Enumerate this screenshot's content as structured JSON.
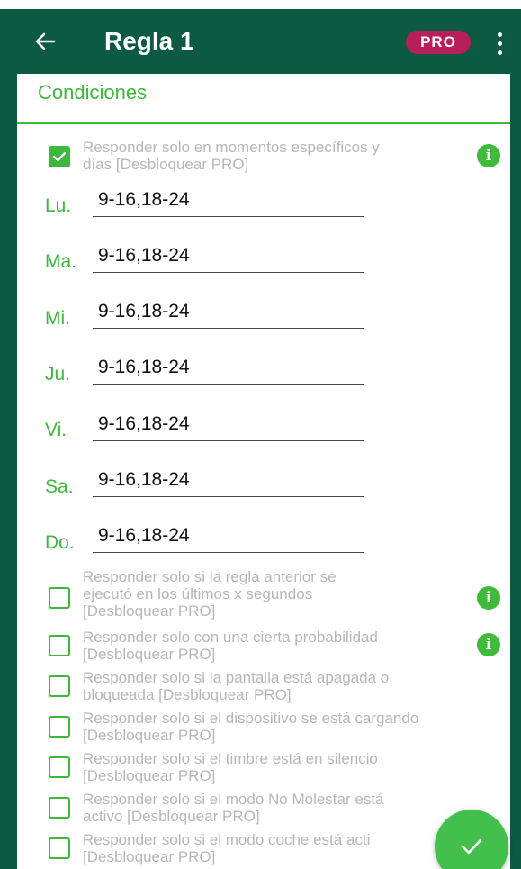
{
  "appbar": {
    "title": "Regla 1",
    "pro_badge": "PRO",
    "back_icon": "arrow-left-icon",
    "menu_icon": "more-vert-icon"
  },
  "section": {
    "title": "Condiciones"
  },
  "time_condition": {
    "checked": true,
    "line1": "Responder solo en momentos específicos y",
    "line2": "días [Desbloquear PRO]"
  },
  "days": [
    {
      "label": "Lu.",
      "value": "9-16,18-24"
    },
    {
      "label": "Ma.",
      "value": "9-16,18-24"
    },
    {
      "label": "Mi.",
      "value": "9-16,18-24"
    },
    {
      "label": "Ju.",
      "value": "9-16,18-24"
    },
    {
      "label": "Vi.",
      "value": "9-16,18-24"
    },
    {
      "label": "Sa.",
      "value": "9-16,18-24"
    },
    {
      "label": "Do.",
      "value": "9-16,18-24"
    }
  ],
  "conditions": [
    {
      "lines": [
        "Responder solo si la regla anterior se",
        "ejecutó en los últimos x segundos",
        "[Desbloquear PRO]"
      ],
      "checked": false,
      "info": true
    },
    {
      "lines": [
        "Responder solo con una cierta probabilidad",
        "[Desbloquear PRO]"
      ],
      "checked": false,
      "info": true
    },
    {
      "lines": [
        "Responder solo si la pantalla está apagada o",
        "bloqueada [Desbloquear PRO]"
      ],
      "checked": false,
      "info": false
    },
    {
      "lines": [
        "Responder solo si el dispositivo se está cargando",
        "[Desbloquear PRO]"
      ],
      "checked": false,
      "info": false
    },
    {
      "lines": [
        "Responder solo si el timbre está en silencio",
        "[Desbloquear PRO]"
      ],
      "checked": false,
      "info": false
    },
    {
      "lines": [
        "Responder solo si el modo No Molestar está",
        "activo [Desbloquear PRO]"
      ],
      "checked": false,
      "info": false
    },
    {
      "lines": [
        "Responder solo si el modo coche está acti",
        "[Desbloquear PRO]"
      ],
      "checked": false,
      "info": false
    }
  ],
  "info_icon_text": "i",
  "fab_icon": "check-icon",
  "colors": {
    "primary_dark": "#0b5a41",
    "accent_green": "#3cb83a",
    "pro_badge": "#b81e5a",
    "disabled_text": "#b7b7b7",
    "fab": "#43c04b"
  }
}
